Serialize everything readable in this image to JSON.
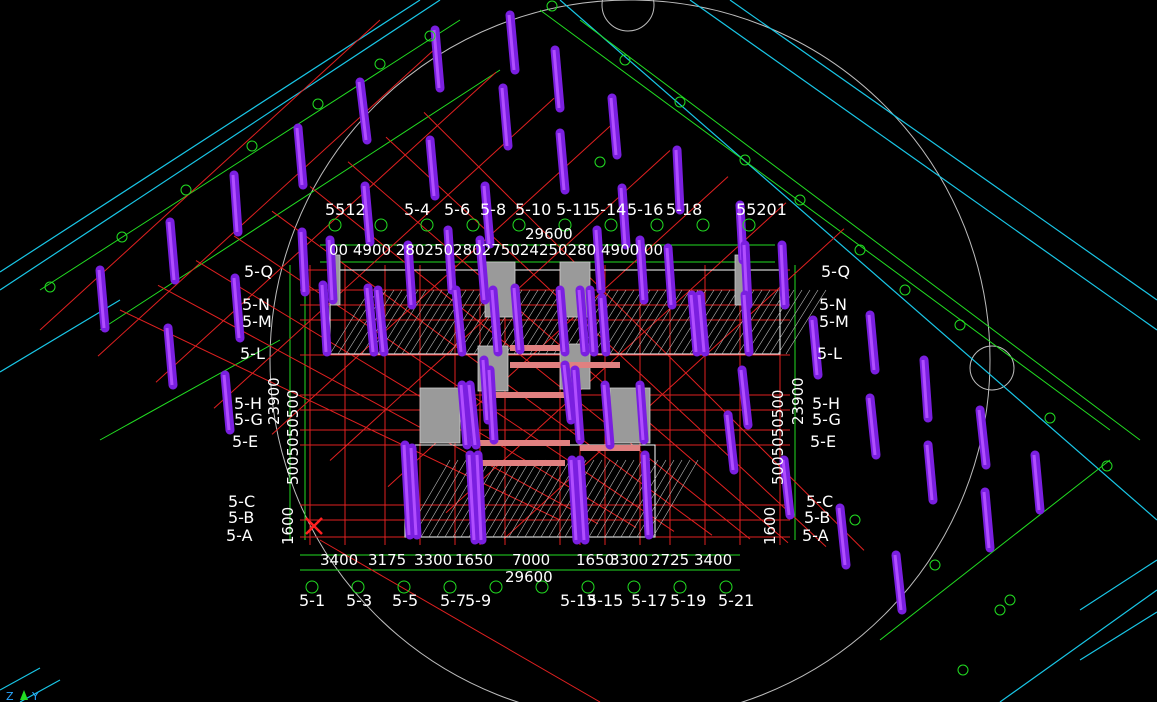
{
  "colors": {
    "background": "#000000",
    "axis_grid": "#e02020",
    "dimension": "#22dd22",
    "site_outline": "#19c6e6",
    "column": "#7a1fe0",
    "column_highlight": "#b04dff",
    "wall": "#9a9a9a",
    "beam": "#e08080",
    "selection_mark": "#ff2020",
    "circle": "#c8c8c8"
  },
  "axes": {
    "top_labels": [
      "5512",
      "5-4",
      "5-6",
      "5-8",
      "5-10",
      "5-11",
      "5-14",
      "5-16",
      "5-18",
      "55201"
    ],
    "bottom_labels": [
      "5-1",
      "5-3",
      "5-5",
      "5-7",
      "5-9",
      "5-13",
      "5-15",
      "5-17",
      "5-19",
      "5-21"
    ],
    "left_labels": [
      "5-Q",
      "5-N",
      "5-M",
      "5-L",
      "5-H",
      "5-G",
      "5-E",
      "5-C",
      "5-B",
      "5-A"
    ],
    "right_labels": [
      "5-Q",
      "5-N",
      "5-M",
      "5-L",
      "5-H",
      "5-G",
      "5-E",
      "5-C",
      "5-B",
      "5-A"
    ]
  },
  "dimensions": {
    "top_total": "29600",
    "top_segments": "00 4900  280250280275024250280   4900 00",
    "bottom_total": "29600",
    "bottom_segments": [
      "3400",
      "3175",
      "3300",
      "1650",
      "7000",
      "1650",
      "3300",
      "2725",
      "3400"
    ],
    "left_total": "23900",
    "left_segments": "5005050500",
    "left_bottom": "1600",
    "right_total": "23900",
    "right_segments": "5005050500",
    "right_bottom": "1600"
  },
  "ucs_icon": "ucs-icon",
  "selection_icon": "x-mark-icon"
}
